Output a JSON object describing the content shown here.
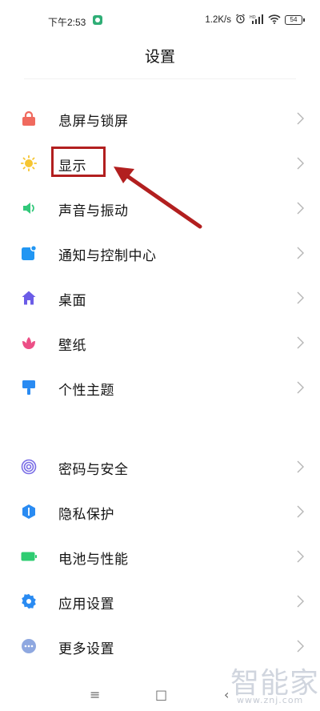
{
  "status_bar": {
    "time": "下午2:53",
    "network_speed": "1.2K/s",
    "battery_level": "54",
    "icons": [
      "app-notification-icon",
      "alarm-icon",
      "hd-signal-icon",
      "wifi-icon",
      "battery-icon"
    ]
  },
  "header": {
    "title": "设置"
  },
  "settings": {
    "items": [
      {
        "label": "息屏与锁屏",
        "icon": "lock-icon",
        "color": "#f06a5e"
      },
      {
        "label": "显示",
        "icon": "sun-icon",
        "color": "#f6c531"
      },
      {
        "label": "声音与振动",
        "icon": "speaker-icon",
        "color": "#32c87a"
      },
      {
        "label": "通知与控制中心",
        "icon": "notification-icon",
        "color": "#2196f3"
      },
      {
        "label": "桌面",
        "icon": "home-icon",
        "color": "#6b5ce7"
      },
      {
        "label": "壁纸",
        "icon": "tulip-icon",
        "color": "#ec4f86"
      },
      {
        "label": "个性主题",
        "icon": "brush-icon",
        "color": "#2a8bf2"
      },
      {
        "label": "密码与安全",
        "icon": "fingerprint-icon",
        "color": "#7a6ee6"
      },
      {
        "label": "隐私保护",
        "icon": "shield-icon",
        "color": "#2a8bf2"
      },
      {
        "label": "电池与性能",
        "icon": "battery-icon",
        "color": "#2ecc71"
      },
      {
        "label": "应用设置",
        "icon": "gear-icon",
        "color": "#2a8bf2"
      },
      {
        "label": "更多设置",
        "icon": "more-icon",
        "color": "#8fa8e0"
      }
    ]
  },
  "annotation": {
    "accent": "#b21f1f"
  },
  "nav_bar": {
    "menu": "≡",
    "home": "□",
    "back": "‹"
  },
  "watermark": {
    "brand": "智能家",
    "site": "www.znj.com"
  }
}
